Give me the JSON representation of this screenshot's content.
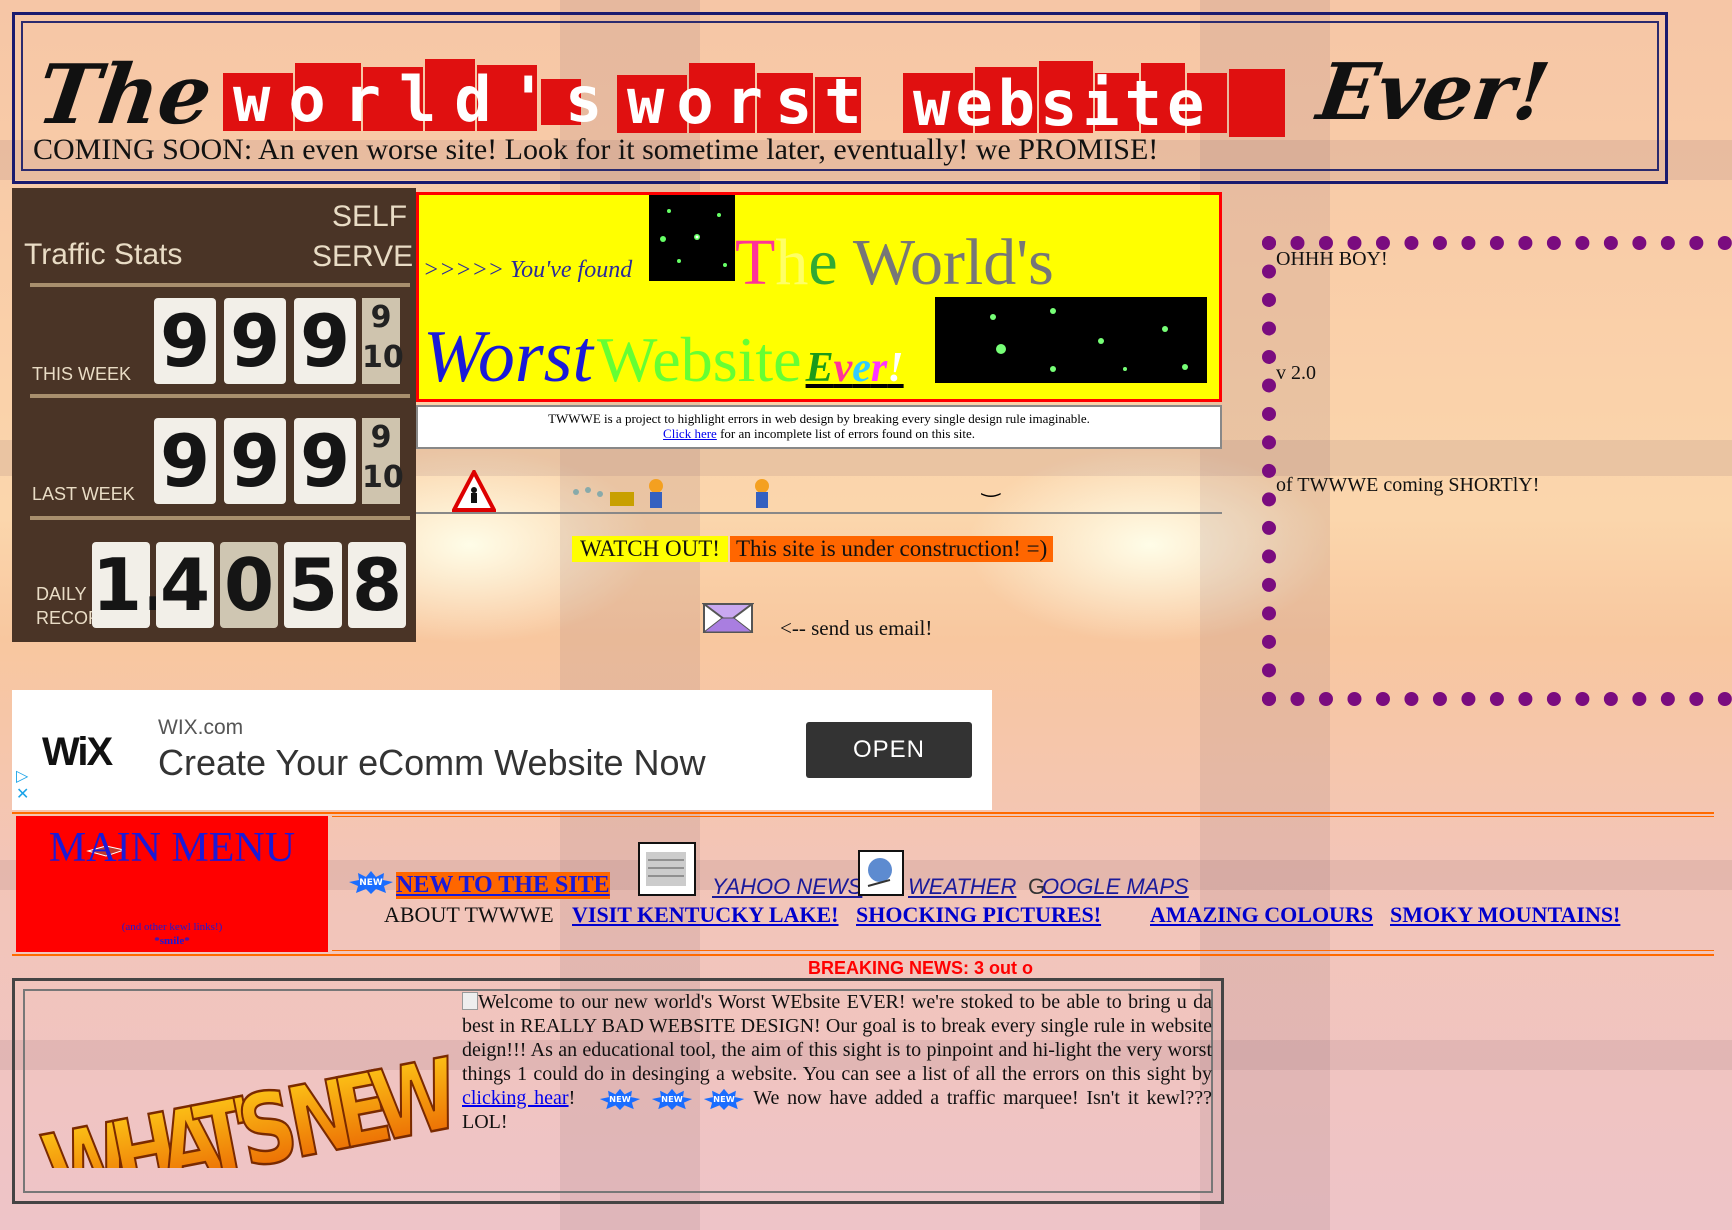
{
  "header": {
    "title_parts": [
      "The",
      "world's",
      "worst",
      "website",
      "Ever!"
    ],
    "coming_soon": "COMING SOON: An even worse site! Look for it sometime later, eventually!  we PROMISE!"
  },
  "traffic": {
    "title": "Traffic Stats",
    "self_serve_1": "SELF",
    "self_serve_2": "SERVE",
    "this_week_label": "THIS WEEK",
    "last_week_label": "LAST WEEK",
    "daily_label_1": "DAILY",
    "daily_label_2": "RECOR",
    "this_week_digits": [
      "9",
      "9",
      "9"
    ],
    "last_week_digits": [
      "9",
      "9",
      "9"
    ],
    "fraction_num": "9",
    "fraction_den": "10",
    "daily_digits": [
      "1.",
      "4",
      "0",
      "5",
      "8"
    ]
  },
  "intro": {
    "found": ">>>>> You've found",
    "title_line1": [
      "T",
      "h",
      "e",
      " World's"
    ],
    "title_line2_worst": "Worst",
    "title_line2_website": "Website",
    "title_line2_ever": [
      "E",
      "v",
      "e",
      "r",
      "!"
    ]
  },
  "description": {
    "line1": "TWWWE is a project to highlight errors in web design by breaking every single design rule imaginable.",
    "link": "Click here",
    "line2_rest": " for an incomplete list of errors found on this site."
  },
  "sidebar_right": {
    "line1": "OHHH BOY!",
    "line2": "v 2.0",
    "line3": "of TWWWE coming SHORTlY!"
  },
  "construction": {
    "watch": "WATCH OUT!",
    "under": "This site is under construction! =)",
    "email": "<-- send us email!",
    "smile": "‿"
  },
  "ad": {
    "logo": "WiX",
    "domain": "WIX.com",
    "headline": "Create Your eComm Website Now",
    "open": "OPEN",
    "adchoice_play": "▷",
    "adchoice_close": "✕"
  },
  "menu": {
    "title": "MAIN MENU",
    "subtitle": "(and other kewl links!)",
    "smile": "*smile*",
    "new_to_site": "NEW TO THE SITE",
    "yahoo": "YAHOO NEWS",
    "weather": "WEATHER",
    "google_g": "G",
    "google_rest": "OOGLE MAPS",
    "about": "ABOUT TWWWE",
    "kentucky": "VISIT KENTUCKY LAKE!",
    "shocking": "SHOCKING PICTURES!",
    "amazing": "AMAZING COLOURS",
    "smoky": "SMOKY MOUNTAINS!"
  },
  "breaking": "BREAKING NEWS:  3 out o",
  "whats_new": {
    "heading_img": "WHAT'S NEW",
    "p1": "Welcome to our new world's Worst WEbsite EVER!  we're stoked to be able to bring u da best in REALLY BAD WEBSITE DESIGN!  Our goal is to break every single rule in website deign!!!     As an educational tool, the aim of this sight is to pinpoint and hi-light the very worst things 1 could do in desinging a website.  You can see a list of all the errors on this sight by ",
    "link": "clicking hear",
    "after_link": "!",
    "new_badge": "NEW",
    "p2": " We now have added a traffic marquee!  Isn't it kewl??? LOL!"
  },
  "colors": {
    "red": "#ff0000",
    "yellow": "#ffff00",
    "purple_dots": "#7a0c7f",
    "orange": "#ff6600",
    "link_blue": "#0000ee"
  }
}
